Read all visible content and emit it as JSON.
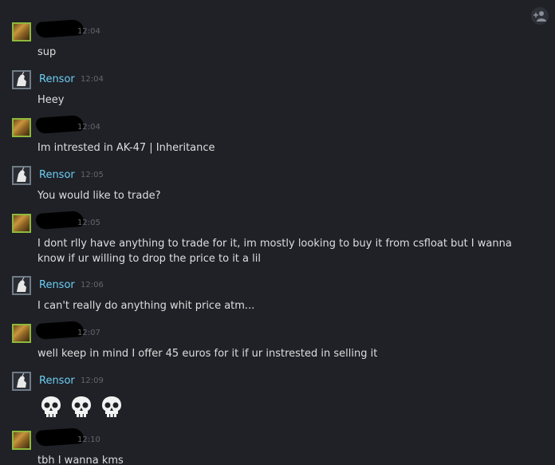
{
  "add_friend": {
    "icon": "add-friend-icon"
  },
  "messages": [
    {
      "author": "",
      "redacted": true,
      "avatar": "lion-avatar",
      "time": "12:04",
      "text": "sup"
    },
    {
      "author": "Rensor",
      "redacted": false,
      "avatar": "rensor-avatar",
      "time": "12:04",
      "text": "Heey"
    },
    {
      "author": "",
      "redacted": true,
      "avatar": "lion-avatar",
      "time": "12:04",
      "text": "Im intrested in AK-47 | Inheritance"
    },
    {
      "author": "Rensor",
      "redacted": false,
      "avatar": "rensor-avatar",
      "time": "12:05",
      "text": "You would like to trade?"
    },
    {
      "author": "",
      "redacted": true,
      "avatar": "lion-avatar",
      "time": "12:05",
      "text": "I dont rlly have anything to trade for it, im mostly looking to buy it from csfloat but I wanna know if ur willing to drop the price to it a lil"
    },
    {
      "author": "Rensor",
      "redacted": false,
      "avatar": "rensor-avatar",
      "time": "12:06",
      "text": "I can't really do anything whit price atm..."
    },
    {
      "author": "",
      "redacted": true,
      "avatar": "lion-avatar",
      "time": "12:07",
      "text": "well keep in mind I offer 45 euros for it if ur instrested in selling it"
    },
    {
      "author": "Rensor",
      "redacted": false,
      "avatar": "rensor-avatar",
      "time": "12:09",
      "emojis": [
        "skull",
        "skull",
        "skull"
      ]
    },
    {
      "author": "",
      "redacted": true,
      "avatar": "lion-avatar",
      "time": "12:10",
      "text": "tbh I wanna kms"
    }
  ]
}
